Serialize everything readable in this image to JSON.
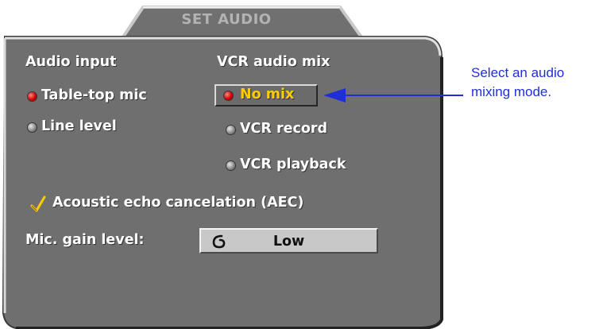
{
  "dialog": {
    "title": "SET AUDIO"
  },
  "audio_input": {
    "heading": "Audio input",
    "options": [
      {
        "label": "Table-top mic",
        "selected": true
      },
      {
        "label": "Line level",
        "selected": false
      }
    ]
  },
  "vcr_mix": {
    "heading": "VCR audio mix",
    "options": [
      {
        "label": "No mix",
        "selected": true
      },
      {
        "label": "VCR record",
        "selected": false
      },
      {
        "label": "VCR playback",
        "selected": false
      }
    ]
  },
  "aec": {
    "label": "Acoustic echo cancelation (AEC)",
    "checked": true
  },
  "mic_gain": {
    "label": "Mic. gain level:",
    "value": "Low"
  },
  "callout": {
    "line1": "Select an audio",
    "line2": "mixing mode."
  },
  "colors": {
    "panel": "#6f6f6f",
    "selected_text": "#ffcc00",
    "callout": "#1f2fd6",
    "radio_on": "#d40000"
  }
}
